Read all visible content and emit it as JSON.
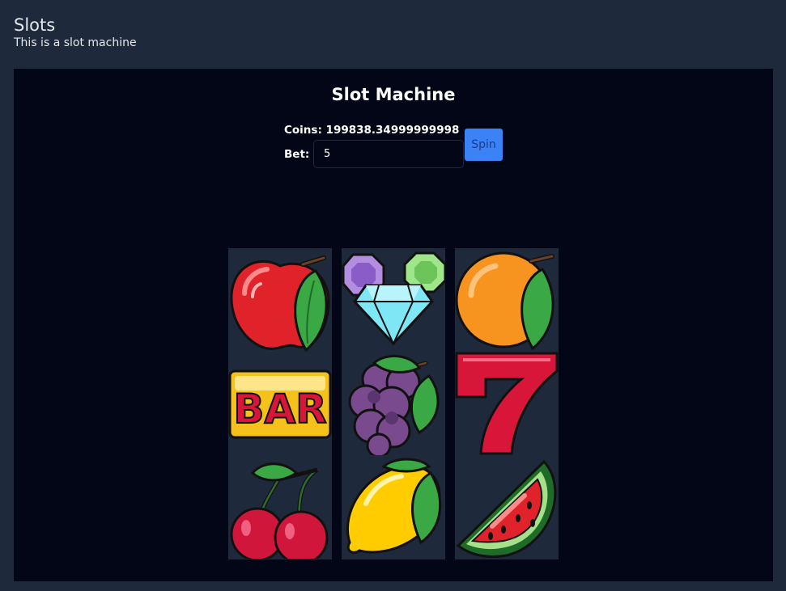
{
  "page": {
    "title": "Slots",
    "subtitle": "This is a slot machine"
  },
  "machine": {
    "title": "Slot Machine",
    "coins_text": "Coins: 199838.34999999998",
    "bet_label": "Bet:",
    "bet_value": "5",
    "spin_label": "Spin"
  },
  "reels": [
    [
      "apple",
      "bar",
      "cherries"
    ],
    [
      "gems",
      "grapes",
      "lemon"
    ],
    [
      "orange",
      "seven",
      "watermelon"
    ]
  ],
  "colors": {
    "page_bg": "#1e293b",
    "panel_bg": "#020617",
    "reel_bg": "#1e293b",
    "spin_button": "#3b82f6"
  }
}
